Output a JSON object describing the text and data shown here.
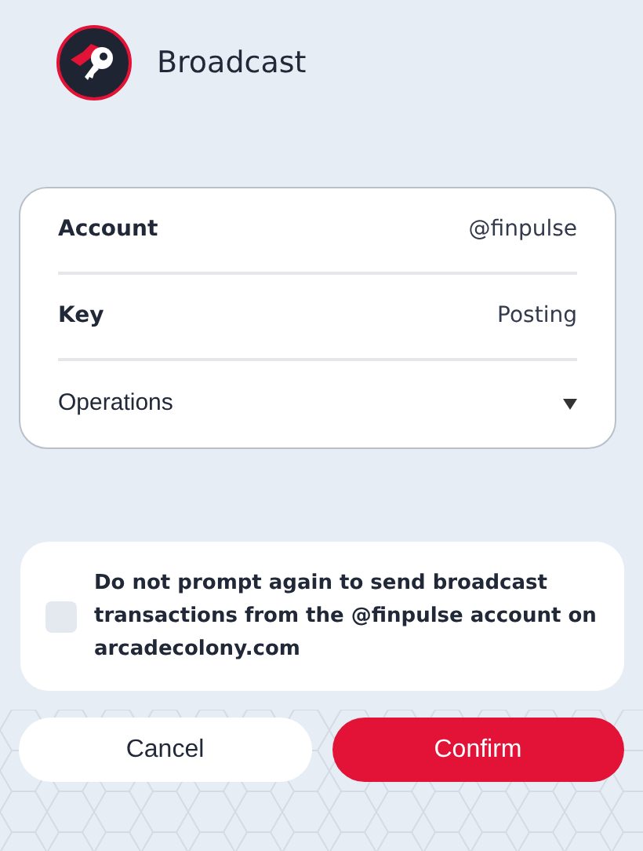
{
  "header": {
    "title": "Broadcast"
  },
  "details": [
    {
      "kind": "field",
      "label": "Account",
      "value": "@finpulse"
    },
    {
      "kind": "field",
      "label": "Key",
      "value": "Posting"
    },
    {
      "kind": "dropdown",
      "label": "Operations",
      "expanded": false
    }
  ],
  "consent": {
    "checked": false,
    "text": "Do not prompt again to send broadcast transactions from the @finpulse account on arcadecolony.com"
  },
  "buttons": [
    {
      "label": "Cancel",
      "kind": "secondary"
    },
    {
      "label": "Confirm",
      "kind": "primary"
    }
  ]
}
